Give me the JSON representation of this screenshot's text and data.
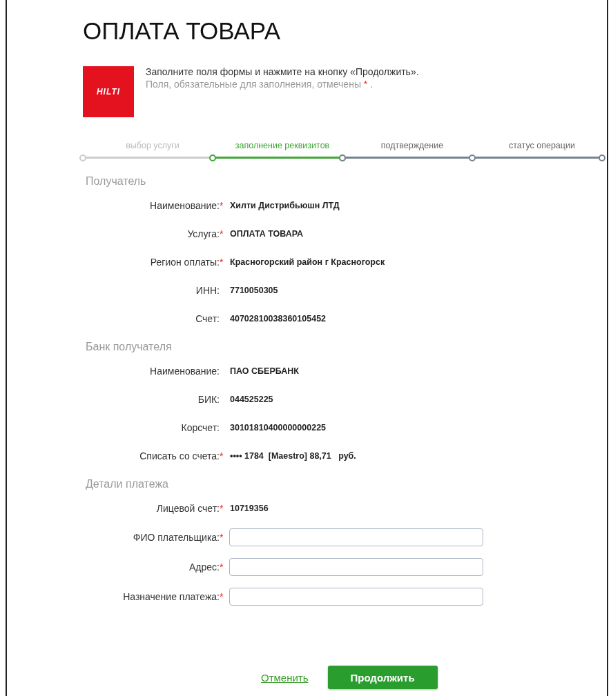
{
  "title": "ОПЛАТА ТОВАРА",
  "logo": {
    "text": "HILTI"
  },
  "intro": {
    "text": "Заполните поля формы и нажмите на кнопку «Продолжить».",
    "note_before": "Поля, обязательные для заполнения, отмечены",
    "note_mark": "*",
    "note_after": " ."
  },
  "steps": [
    {
      "label": "выбор услуги",
      "kind": "done"
    },
    {
      "label": "заполнение реквизитов",
      "kind": "current"
    },
    {
      "label": "подтверждение",
      "kind": "pending"
    },
    {
      "label": "статус операции",
      "kind": "pending"
    }
  ],
  "required_mark": "*",
  "sections": [
    {
      "title": "Получатель",
      "rows": [
        {
          "kind": "text",
          "label": "Наименование:",
          "required": true,
          "value": "Хилти Дистрибьюшн ЛТД"
        },
        {
          "kind": "text",
          "label": "Услуга:",
          "required": true,
          "value": "ОПЛАТА ТОВАРА"
        },
        {
          "kind": "text",
          "label": "Регион оплаты:",
          "required": true,
          "value": "Красногорский район г Красногорск"
        },
        {
          "kind": "text",
          "label": "ИНН:",
          "required": false,
          "value": "7710050305"
        },
        {
          "kind": "text",
          "label": "Счет:",
          "required": false,
          "value": "40702810038360105452"
        }
      ]
    },
    {
      "title": "Банк получателя",
      "rows": [
        {
          "kind": "text",
          "label": "Наименование:",
          "required": false,
          "value": "ПАО СБЕРБАНК"
        },
        {
          "kind": "text",
          "label": "БИК:",
          "required": false,
          "value": "044525225"
        },
        {
          "kind": "text",
          "label": "Корсчет:",
          "required": false,
          "value": "30101810400000000225"
        },
        {
          "kind": "text",
          "label": "Списать со счета:",
          "required": true,
          "value": "•••• 1784  [Maestro] 88,71   руб."
        }
      ]
    },
    {
      "title": "Детали платежа",
      "rows": [
        {
          "kind": "text",
          "label": "Лицевой счет:",
          "required": true,
          "value": "10719356"
        },
        {
          "kind": "input",
          "label": "ФИО плательщика:",
          "required": true
        },
        {
          "kind": "input",
          "label": "Адрес:",
          "required": true
        },
        {
          "kind": "input",
          "label": "Назначение платежа:",
          "required": true
        }
      ]
    }
  ],
  "actions": {
    "cancel": "Отменить",
    "submit": "Продолжить"
  }
}
